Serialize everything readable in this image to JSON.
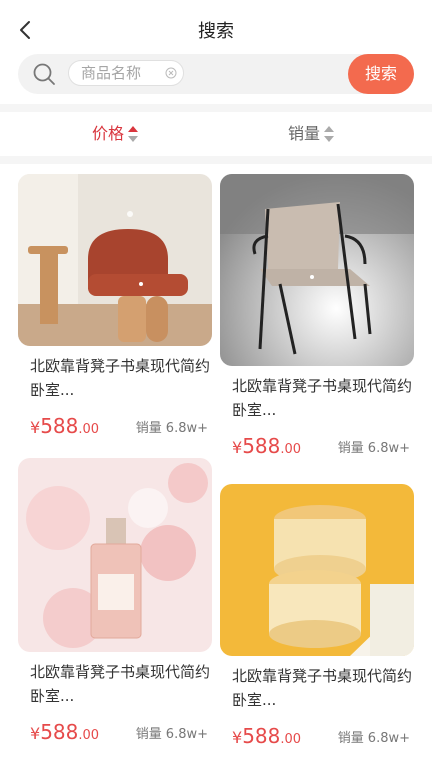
{
  "header": {
    "title": "搜索"
  },
  "search": {
    "placeholder": "商品名称",
    "button": "搜索"
  },
  "sort": {
    "price": "价格",
    "sales": "销量"
  },
  "colors": {
    "accent": "#f36a4e",
    "price": "#e64a4a",
    "active": "#d9363e"
  },
  "products": [
    {
      "name": "北欧靠背凳子书桌现代简约卧室...",
      "price_int": "588",
      "price_dec": ".00",
      "currency": "¥",
      "sales_label": "销量",
      "sales_value": "6.8w+"
    },
    {
      "name": "北欧靠背凳子书桌现代简约卧室...",
      "price_int": "588",
      "price_dec": ".00",
      "currency": "¥",
      "sales_label": "销量",
      "sales_value": "6.8w+"
    },
    {
      "name": "北欧靠背凳子书桌现代简约卧室...",
      "price_int": "588",
      "price_dec": ".00",
      "currency": "¥",
      "sales_label": "销量",
      "sales_value": "6.8w+"
    },
    {
      "name": "北欧靠背凳子书桌现代简约卧室...",
      "price_int": "588",
      "price_dec": ".00",
      "currency": "¥",
      "sales_label": "销量",
      "sales_value": "6.8w+"
    }
  ]
}
